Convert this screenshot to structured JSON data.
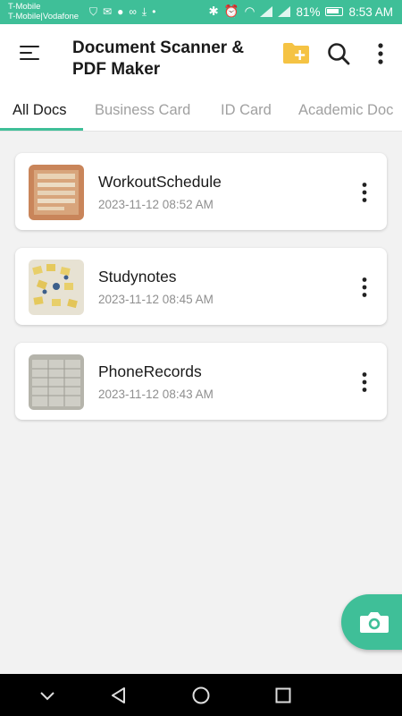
{
  "status_bar": {
    "carrier_line1": "T-Mobile",
    "carrier_line2": "T-Mobile|Vodafone",
    "battery": "81%",
    "time": "8:53 AM",
    "background": "#3fbf98"
  },
  "header": {
    "title": "Document Scanner & PDF Maker",
    "icons": [
      "menu-icon",
      "folder-add-icon",
      "search-icon",
      "more-vert-icon"
    ]
  },
  "tabs": [
    {
      "label": "All Docs",
      "active": true
    },
    {
      "label": "Business Card",
      "active": false
    },
    {
      "label": "ID Card",
      "active": false
    },
    {
      "label": "Academic Doc",
      "active": false
    }
  ],
  "documents": [
    {
      "name": "WorkoutSchedule",
      "date": "2023-11-12  08:52 AM"
    },
    {
      "name": "Studynotes",
      "date": "2023-11-12  08:45 AM"
    },
    {
      "name": "PhoneRecords",
      "date": "2023-11-12  08:43 AM"
    }
  ],
  "fab": {
    "icon": "camera-icon"
  },
  "colors": {
    "accent": "#3fbf98",
    "folder": "#f5c344"
  }
}
